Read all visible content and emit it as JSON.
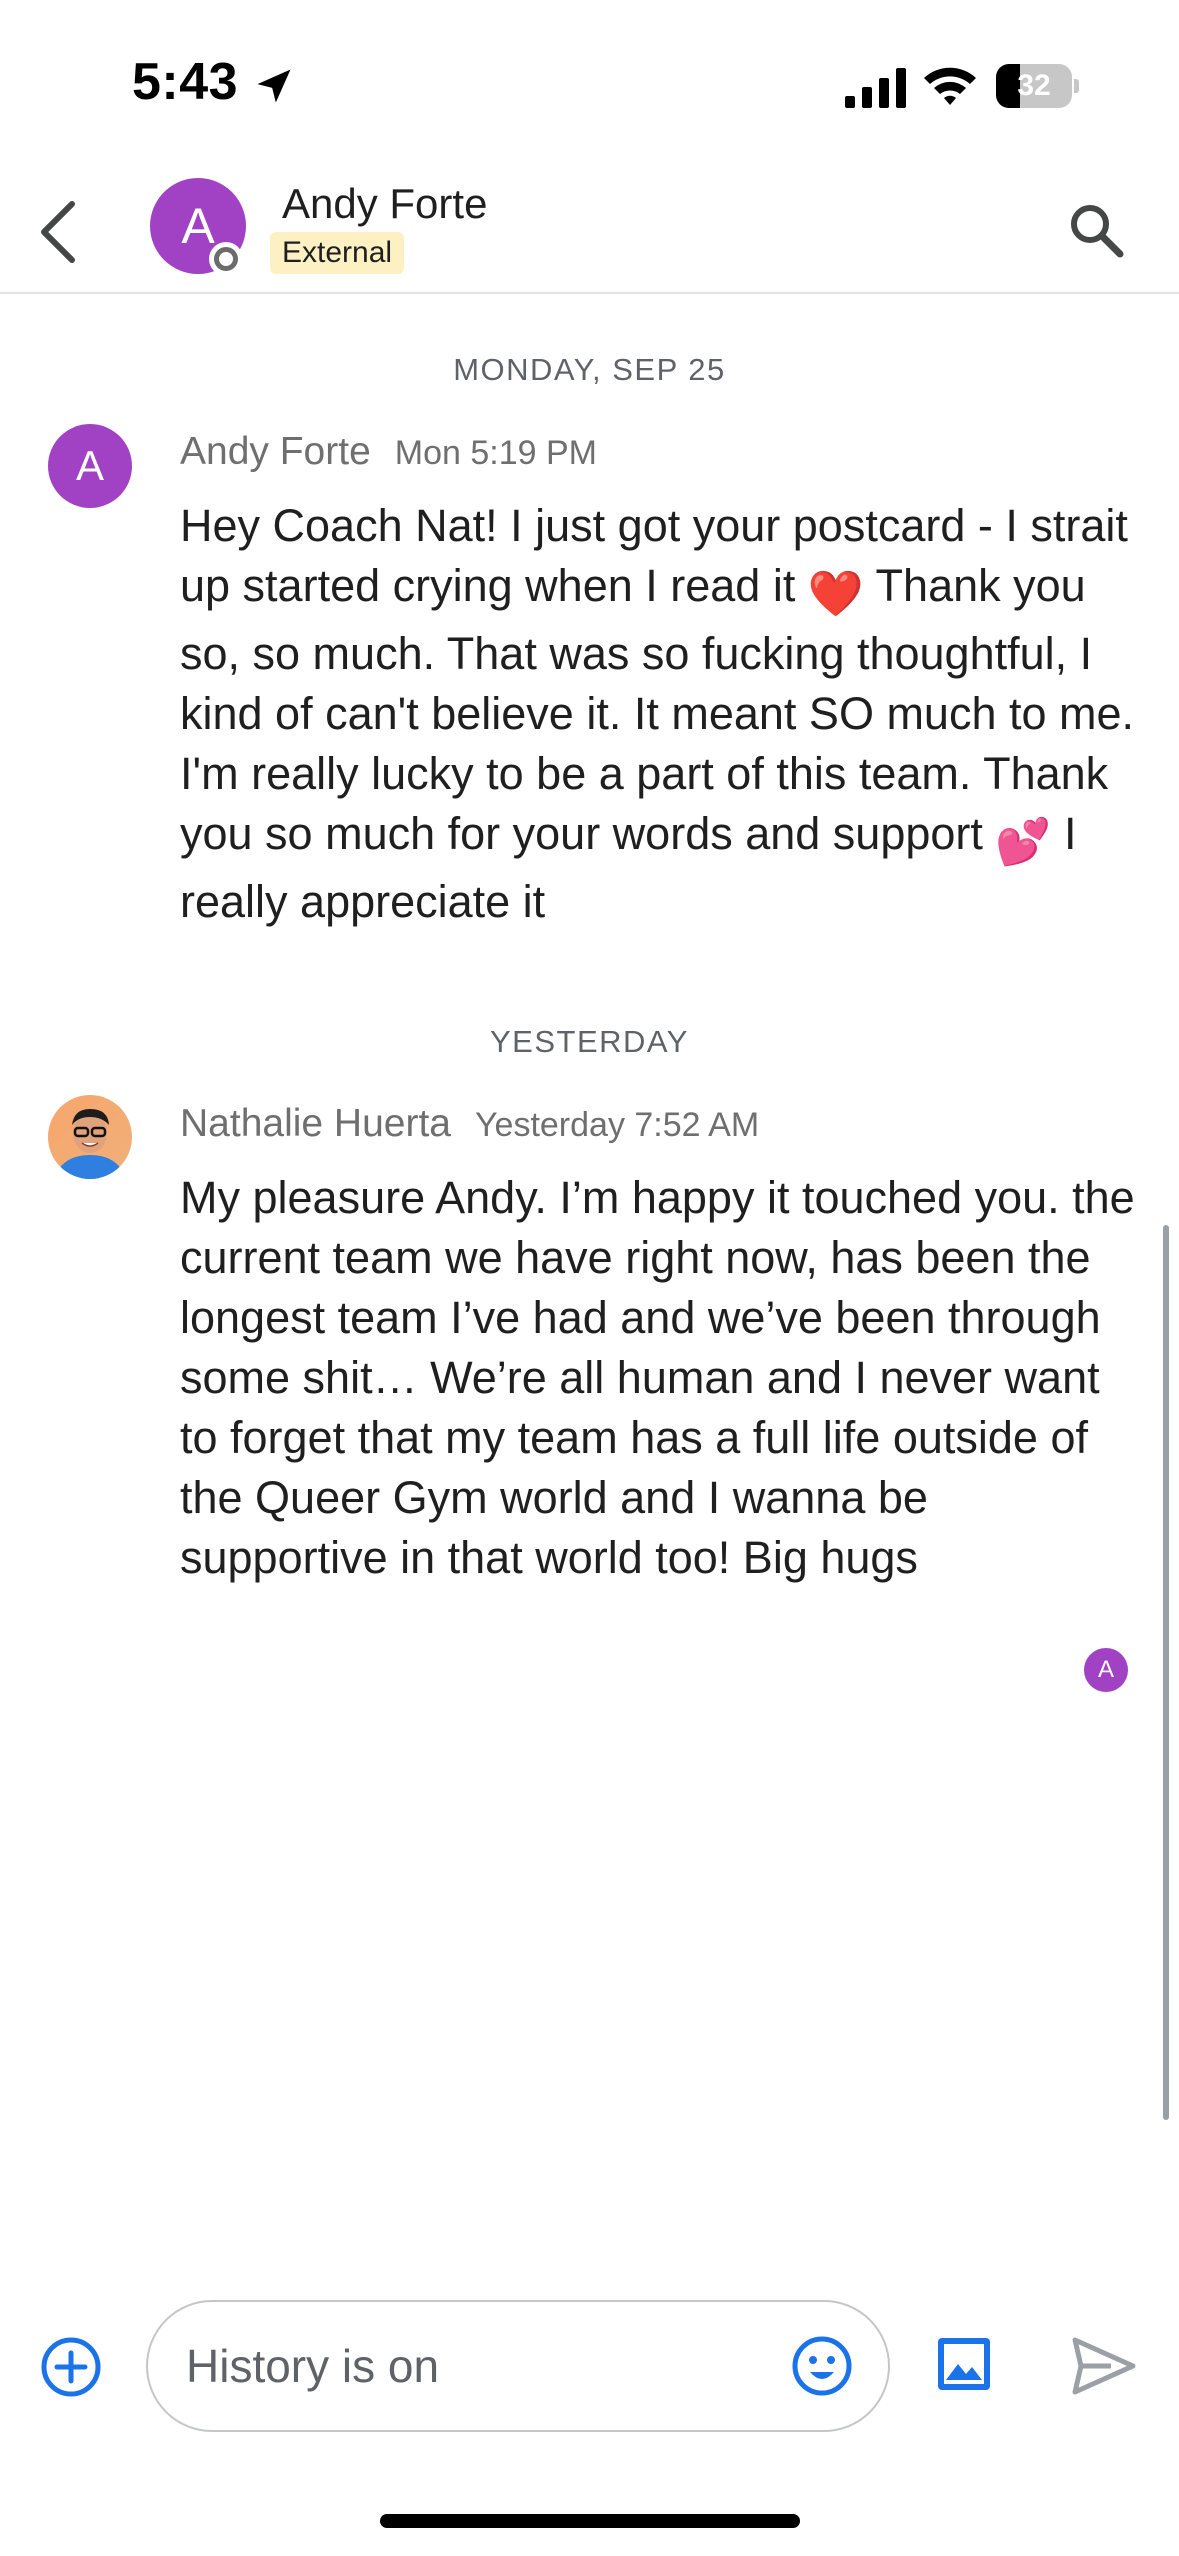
{
  "status_bar": {
    "time": "5:43",
    "battery_level": "32",
    "battery_fraction": 0.32
  },
  "header": {
    "contact_name": "Andy Forte",
    "avatar_letter": "A",
    "badge": "External",
    "icons": [
      "back-arrow-icon",
      "presence-icon",
      "search-icon"
    ]
  },
  "conversation": {
    "groups": [
      {
        "date": "MONDAY, SEP 25",
        "message": {
          "sender": "Andy Forte",
          "avatar_letter": "A",
          "time": "Mon 5:19 PM",
          "text_parts": [
            "Hey Coach Nat! I just got your postcard - I strait up started crying when I read it ",
            "❤️",
            " Thank you so, so much. That was so fucking thoughtful, I kind of can't believe it. It meant SO much to me. I'm really lucky to be a part of this team. Thank you so much for your words and support ",
            "💕",
            "  I really appreciate it"
          ]
        }
      },
      {
        "date": "YESTERDAY",
        "message": {
          "sender": "Nathalie Huerta",
          "time": "Yesterday 7:52 AM",
          "text": "My pleasure Andy. I’m happy it touched you. the current team we have right now, has been the longest team I’ve had and we’ve been through some shit… We’re all human and I never want to forget that my team has a full life outside of the Queer Gym world and I wanna be supportive in that world too! Big hugs"
        }
      }
    ],
    "read_receipt_letter": "A"
  },
  "composer": {
    "placeholder": "History is on",
    "value": "",
    "icons": [
      "add-circle-icon",
      "emoji-icon",
      "image-icon",
      "send-icon"
    ]
  },
  "colors": {
    "accent_blue": "#1a73e8",
    "avatar_purple": "#a142c5",
    "badge_bg": "#fdf1c4",
    "send_disabled": "#9aa0a6"
  }
}
